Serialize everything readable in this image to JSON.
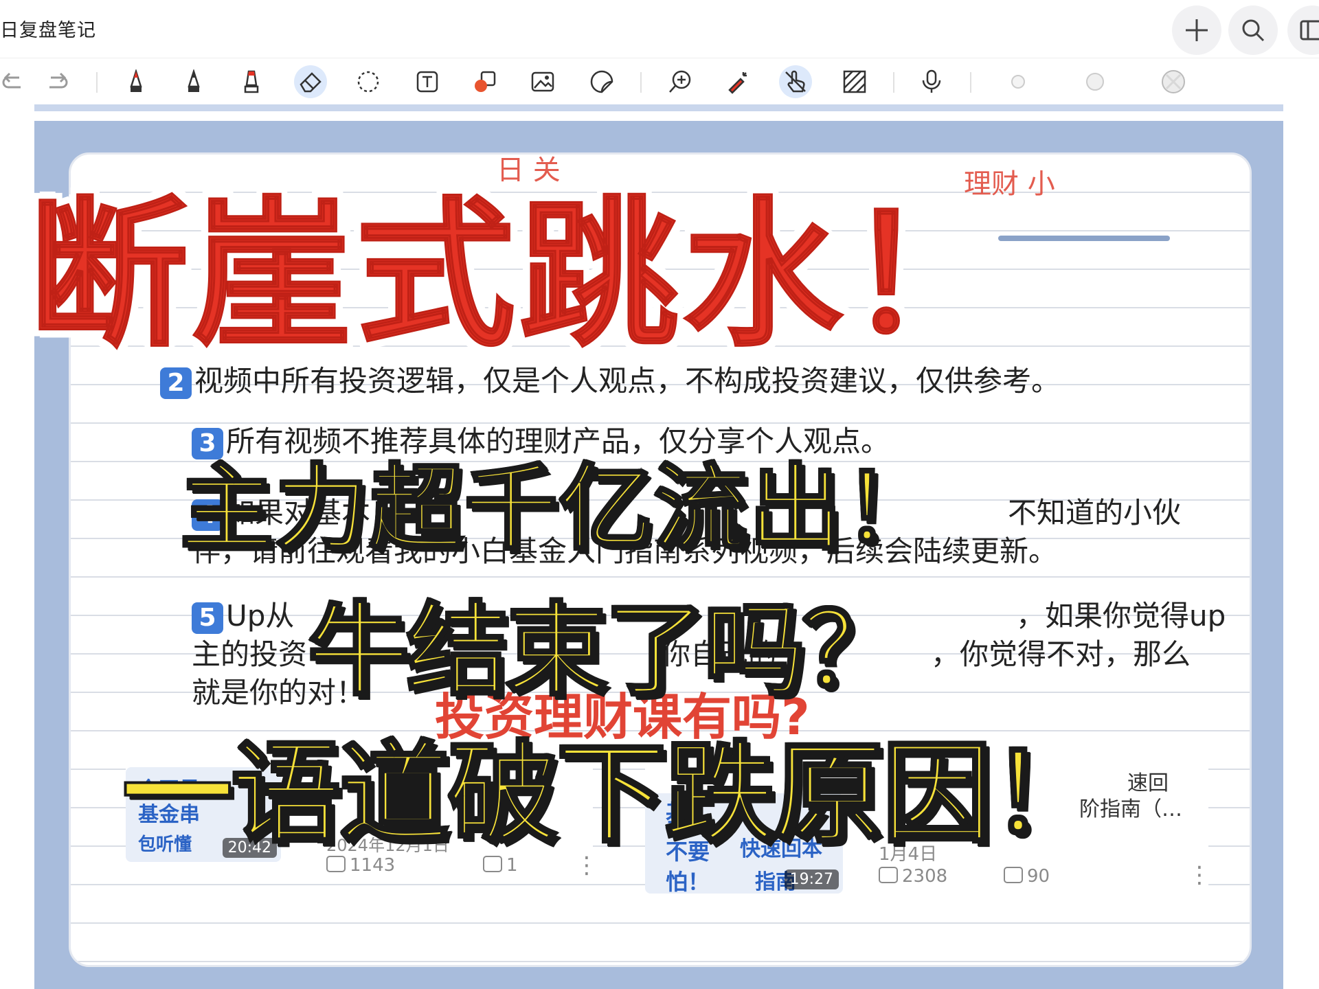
{
  "app": {
    "doc_title": "日复盘笔记"
  },
  "toolbar": {
    "icons": [
      "undo-icon",
      "redo-icon",
      "pen-icon",
      "fountain-pen-icon",
      "highlighter-icon",
      "eraser-icon",
      "lasso-icon",
      "text-box-icon",
      "shapes-icon",
      "image-icon",
      "sticker-icon",
      "zoom-icon",
      "laser-pointer-icon",
      "hand-touch-icon",
      "hatch-icon",
      "microphone-icon",
      "color-dot-1",
      "color-dot-2",
      "color-dot-3"
    ],
    "active": [
      "eraser-icon",
      "hand-touch-icon"
    ]
  },
  "note": {
    "fragment_logic": "逻",
    "line2_rest": "视频中所有投资逻辑，仅是个人观点，不构成投资建议，仅供参考。",
    "item3": "所有视频不推荐具体的理财产品，仅分享个人观点。",
    "item4_line1_a": "如果对基本",
    "item4_line1_b": "不知道的小伙",
    "item4_line2": "伴，请前往观看我的小白基金入门指南系列视频，后续会陆续更新。",
    "item5_num": "5",
    "item5_line1_a": "Up从",
    "item5_line1_b": "，如果你觉得up",
    "item5_line2_a": "主的投资",
    "item5_line2_b": "你自己的",
    "item5_line2_c": "，你觉得不对，那么",
    "item5_line3": "就是你的对！",
    "badge3": "3",
    "badge4": "4"
  },
  "handwriting": {
    "top_left": "日 关",
    "top_right": "理财 小",
    "bottom": "投资理财课有吗?"
  },
  "videos": [
    {
      "thumb_text_1": "全网最",
      "thumb_text_2": "基金串",
      "thumb_text_3": "包听懂",
      "duration": "20:42",
      "date": "2024年12月1日",
      "views": "1143",
      "comments": "1"
    },
    {
      "title_line1": "速回",
      "title_line2": "阶指南（…",
      "thumb_text_1": "基",
      "thumb_text_2": "不要",
      "thumb_text_3": "快速回本",
      "thumb_text_4": "怕！",
      "thumb_text_5": "指南",
      "duration": "19:27",
      "date": "1月4日",
      "views": "2308",
      "comments": "90"
    }
  ],
  "overlay": {
    "headline_main": "断崖式跳水！",
    "headline_2": "主力超千亿流出！",
    "headline_3": "牛结束了吗？",
    "headline_4": "一语道破下跌原因！"
  },
  "colors": {
    "headline_red": "#e53325",
    "headline_yellow": "#f7e239",
    "page_blue": "#a8bcdc",
    "badge_blue": "#3e7bd8",
    "handwriting_red": "#e03a2b"
  }
}
